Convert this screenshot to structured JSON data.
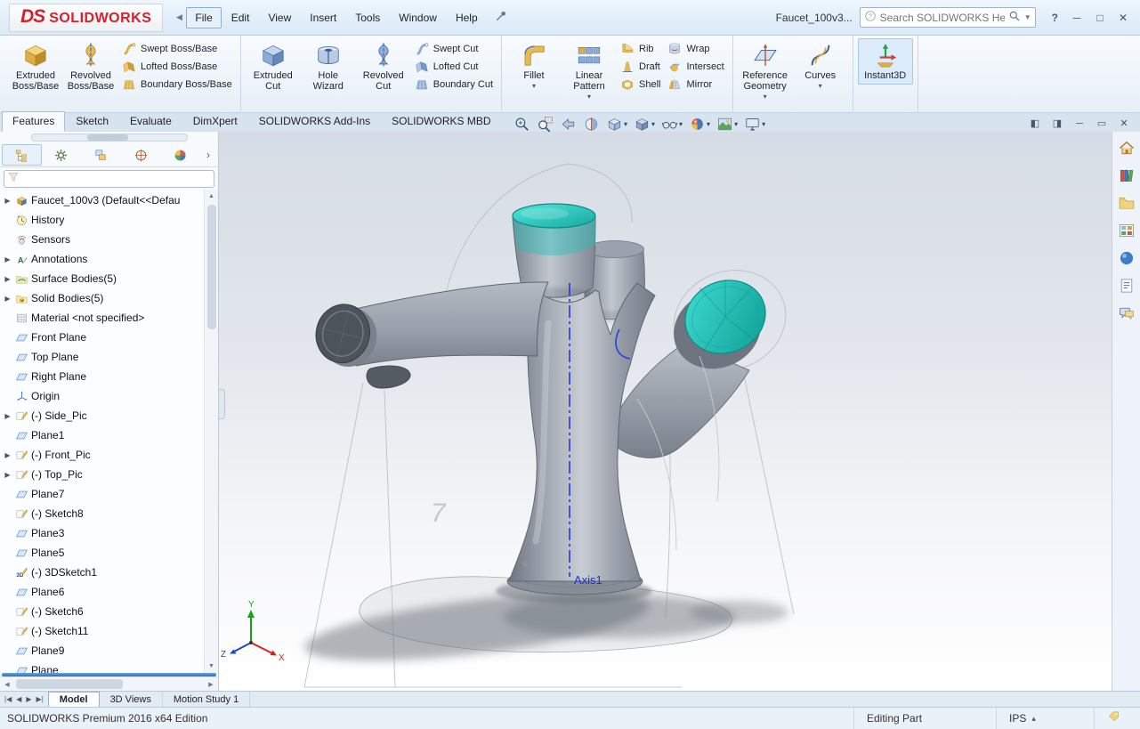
{
  "window": {
    "logo_ds": "DS",
    "logo_brand": "SOLIDWORKS",
    "menus": [
      "File",
      "Edit",
      "View",
      "Insert",
      "Tools",
      "Window",
      "Help"
    ],
    "active_menu": "File",
    "doc_title": "Faucet_100v3...",
    "search_placeholder": "Search SOLIDWORKS Help"
  },
  "titlebar_controls": [
    {
      "name": "minimize-window",
      "glyph": "─"
    },
    {
      "name": "maximize-window",
      "glyph": "□"
    },
    {
      "name": "close-window",
      "glyph": "✕"
    }
  ],
  "window_controls": [
    {
      "name": "pane-left",
      "glyph": "◧"
    },
    {
      "name": "pane-right",
      "glyph": "◨"
    },
    {
      "name": "minimize-document",
      "glyph": "─"
    },
    {
      "name": "restore-document",
      "glyph": "▭"
    },
    {
      "name": "close-document",
      "glyph": "✕"
    }
  ],
  "glyphs": {
    "menu_collapse": "◀",
    "search_dd": "▼",
    "help": "?",
    "dd": "▾",
    "chevron_right": "›",
    "tree_arrow": "▶",
    "scroll_up": "▲",
    "scroll_down": "▼",
    "scroll_left": "◀",
    "scroll_right": "▶",
    "units_dd": "▴"
  },
  "ribbon": {
    "tabs": [
      {
        "label": "Features",
        "active": true
      },
      {
        "label": "Sketch"
      },
      {
        "label": "Evaluate"
      },
      {
        "label": "DimXpert"
      },
      {
        "label": "SOLIDWORKS Add-Ins"
      },
      {
        "label": "SOLIDWORKS MBD"
      }
    ],
    "groups": [
      {
        "large": [
          {
            "label": "Extruded Boss/Base",
            "icon": "extruded-boss"
          },
          {
            "label": "Revolved Boss/Base",
            "icon": "revolved-boss"
          }
        ],
        "stacks": [
          [
            {
              "label": "Swept Boss/Base",
              "icon": "swept-boss"
            },
            {
              "label": "Lofted Boss/Base",
              "icon": "lofted-boss"
            },
            {
              "label": "Boundary Boss/Base",
              "icon": "boundary-boss"
            }
          ]
        ]
      },
      {
        "large": [
          {
            "label": "Extruded Cut",
            "icon": "extruded-cut"
          },
          {
            "label": "Hole Wizard",
            "icon": "hole-wizard"
          },
          {
            "label": "Revolved Cut",
            "icon": "revolved-cut"
          }
        ],
        "stacks": [
          [
            {
              "label": "Swept Cut",
              "icon": "swept-cut"
            },
            {
              "label": "Lofted Cut",
              "icon": "lofted-cut"
            },
            {
              "label": "Boundary Cut",
              "icon": "boundary-cut"
            }
          ]
        ]
      },
      {
        "large": [
          {
            "label": "Fillet",
            "icon": "fillet",
            "dropdown": true
          },
          {
            "label": "Linear Pattern",
            "icon": "linear-pattern",
            "dropdown": true
          }
        ],
        "stacks": [
          [
            {
              "label": "Rib",
              "icon": "rib"
            },
            {
              "label": "Draft",
              "icon": "draft"
            },
            {
              "label": "Shell",
              "icon": "shell"
            }
          ],
          [
            {
              "label": "Wrap",
              "icon": "wrap"
            },
            {
              "label": "Intersect",
              "icon": "intersect"
            },
            {
              "label": "Mirror",
              "icon": "mirror"
            }
          ]
        ]
      },
      {
        "large": [
          {
            "label": "Reference Geometry",
            "icon": "reference-geometry",
            "dropdown": true
          },
          {
            "label": "Curves",
            "icon": "curves",
            "dropdown": true
          }
        ],
        "stacks": []
      },
      {
        "large": [
          {
            "label": "Instant3D",
            "icon": "instant3d",
            "active": true
          }
        ],
        "stacks": []
      }
    ]
  },
  "headsup": [
    {
      "icon": "zoom-fit"
    },
    {
      "icon": "zoom-area"
    },
    {
      "icon": "previous-view"
    },
    {
      "icon": "section-view"
    },
    {
      "icon": "view-orientation",
      "dropdown": true
    },
    {
      "icon": "display-style",
      "dropdown": true
    },
    {
      "icon": "hide-show",
      "dropdown": true
    },
    {
      "icon": "edit-appearance",
      "dropdown": true
    },
    {
      "icon": "apply-scene",
      "dropdown": true
    },
    {
      "icon": "view-settings",
      "dropdown": true
    }
  ],
  "panel": {
    "tabs": [
      {
        "icon": "featuremanager",
        "active": true
      },
      {
        "icon": "propertymanager"
      },
      {
        "icon": "configurationmanager"
      },
      {
        "icon": "dimxpertmanager"
      },
      {
        "icon": "displaymanager"
      }
    ],
    "filter_value": ""
  },
  "tree": {
    "items": [
      {
        "label": "Faucet_100v3  (Default<<Defau",
        "icon": "part",
        "arrow": true
      },
      {
        "label": "History",
        "icon": "history"
      },
      {
        "label": "Sensors",
        "icon": "sensors"
      },
      {
        "label": "Annotations",
        "icon": "annotations",
        "arrow": true
      },
      {
        "label": "Surface Bodies(5)",
        "icon": "surface-folder",
        "arrow": true
      },
      {
        "label": "Solid Bodies(5)",
        "icon": "solid-folder",
        "arrow": true
      },
      {
        "label": "Material <not specified>",
        "icon": "material"
      },
      {
        "label": "Front Plane",
        "icon": "plane"
      },
      {
        "label": "Top Plane",
        "icon": "plane"
      },
      {
        "label": "Right Plane",
        "icon": "plane"
      },
      {
        "label": "Origin",
        "icon": "origin"
      },
      {
        "label": "(-) Side_Pic",
        "icon": "sketch",
        "arrow": true
      },
      {
        "label": "Plane1",
        "icon": "plane"
      },
      {
        "label": "(-) Front_Pic",
        "icon": "sketch",
        "arrow": true
      },
      {
        "label": "(-) Top_Pic",
        "icon": "sketch",
        "arrow": true
      },
      {
        "label": "Plane7",
        "icon": "plane"
      },
      {
        "label": "(-) Sketch8",
        "icon": "sketch"
      },
      {
        "label": "Plane3",
        "icon": "plane"
      },
      {
        "label": "Plane5",
        "icon": "plane"
      },
      {
        "label": "(-) 3DSketch1",
        "icon": "sketch3d"
      },
      {
        "label": "Plane6",
        "icon": "plane"
      },
      {
        "label": "(-) Sketch6",
        "icon": "sketch"
      },
      {
        "label": "(-) Sketch11",
        "icon": "sketch"
      },
      {
        "label": "Plane9",
        "icon": "plane"
      },
      {
        "label": "Plane",
        "icon": "plane"
      }
    ]
  },
  "viewport": {
    "axis_label": "Axis1",
    "ghost_numeral": "7",
    "point_marker": "*",
    "triad": {
      "x": "X",
      "y": "Y",
      "z": "Z"
    }
  },
  "taskpane": [
    {
      "icon": "home"
    },
    {
      "icon": "design-library"
    },
    {
      "icon": "file-explorer"
    },
    {
      "icon": "view-palette"
    },
    {
      "icon": "appearances"
    },
    {
      "icon": "custom-properties"
    },
    {
      "icon": "forum"
    }
  ],
  "doctabs": {
    "nav": [
      "|◀",
      "◀",
      "▶",
      "▶|"
    ],
    "tabs": [
      {
        "label": "Model",
        "active": true
      },
      {
        "label": "3D Views"
      },
      {
        "label": "Motion Study 1"
      }
    ]
  },
  "statusbar": {
    "app_edition": "SOLIDWORKS Premium 2016 x64 Edition",
    "mode": "Editing Part",
    "units": "IPS"
  },
  "colors": {
    "teal": "#2bd0c6",
    "logo_red": "#d6212b",
    "axis_blue": "#1d2de0",
    "body_gray": "#9aa0ab"
  }
}
